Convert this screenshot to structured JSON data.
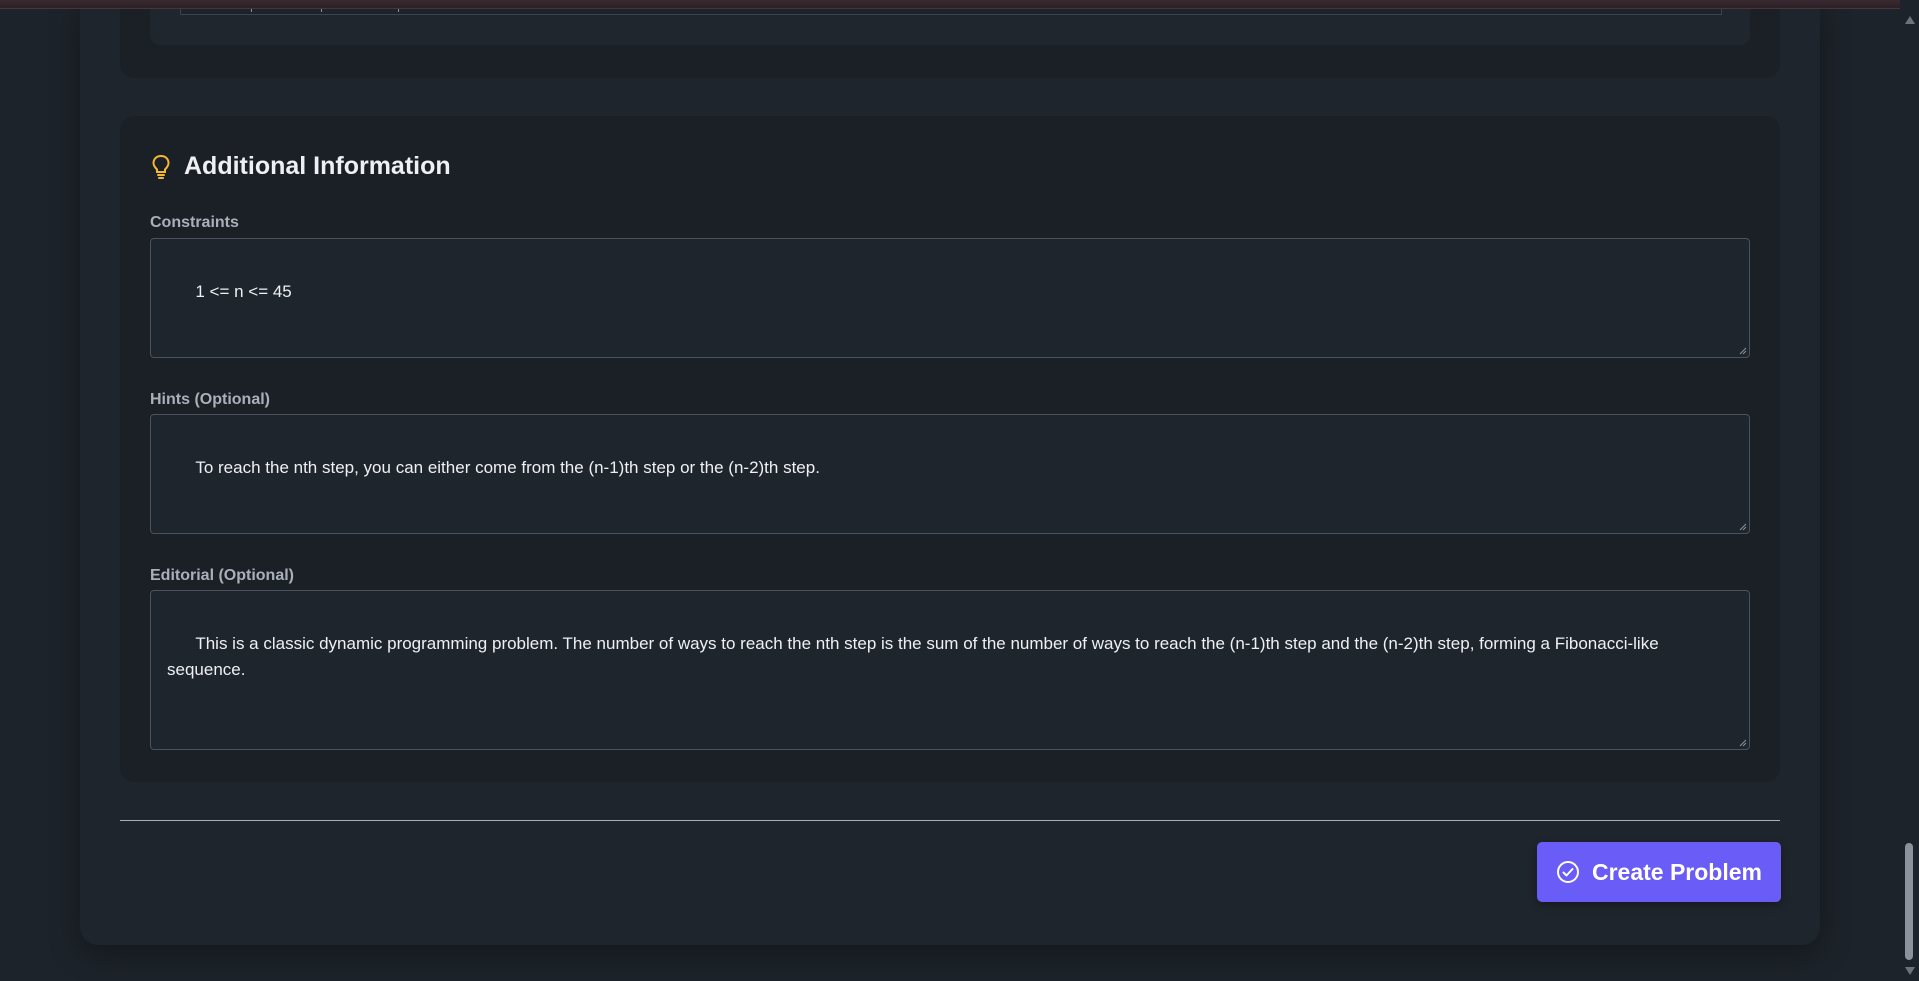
{
  "section": {
    "title": "Additional Information",
    "icon": "lightbulb-icon"
  },
  "fields": {
    "constraints": {
      "label": "Constraints",
      "value": "1 <= n <= 45"
    },
    "hints": {
      "label": "Hints (Optional)",
      "value": "To reach the nth step, you can either come from the (n-1)th step or the (n-2)th step."
    },
    "editorial": {
      "label": "Editorial (Optional)",
      "value": "This is a classic dynamic programming problem. The number of ways to reach the nth step is the sum of the number of ways to reach the (n-1)th step and the (n-2)th step, forming a Fibonacci-like sequence."
    }
  },
  "actions": {
    "create_label": "Create Problem",
    "create_icon": "check-circle-icon"
  },
  "colors": {
    "accent": "#6a5cf6",
    "icon_yellow": "#f5b82e",
    "background": "#1d232a",
    "card": "#1b2027"
  }
}
